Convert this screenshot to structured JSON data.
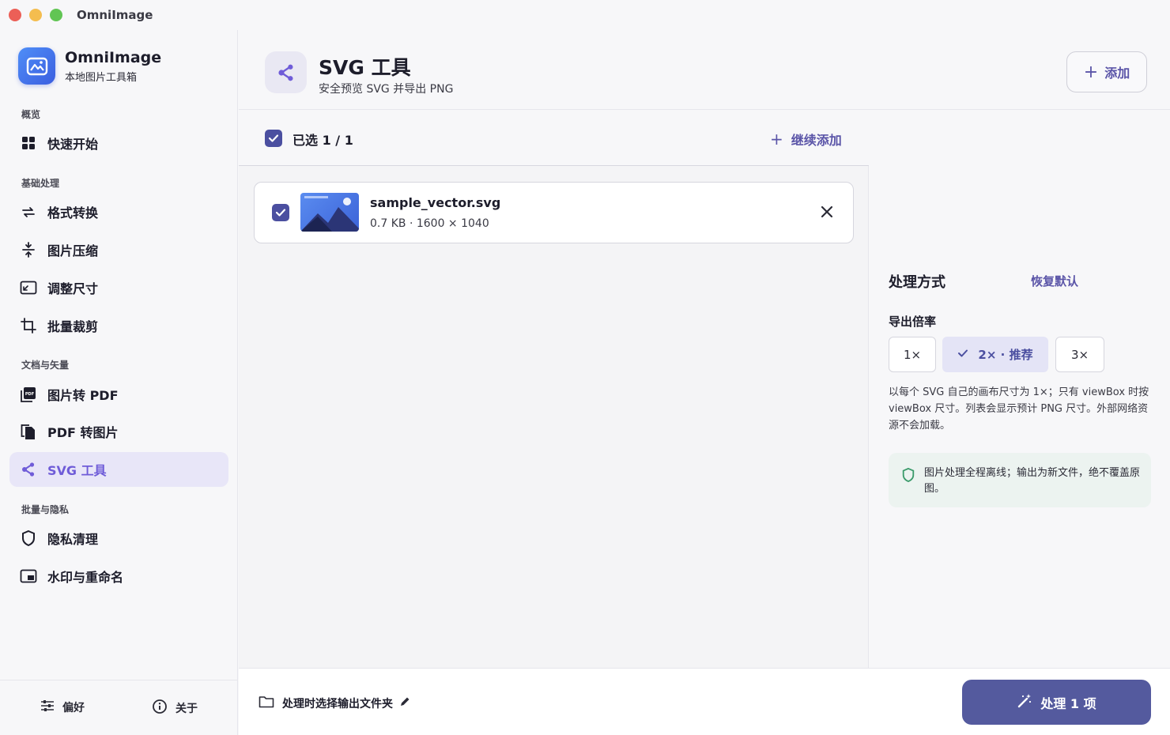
{
  "window": {
    "title": "OmniImage"
  },
  "brand": {
    "name": "OmniImage",
    "subtitle": "本地图片工具箱"
  },
  "sidebar": {
    "sections": [
      {
        "label": "概览"
      },
      {
        "label": "基础处理"
      },
      {
        "label": "文档与矢量"
      },
      {
        "label": "批量与隐私"
      }
    ],
    "items": [
      {
        "label": "快速开始",
        "icon": "grid-icon"
      },
      {
        "label": "格式转换",
        "icon": "swap-arrows-icon"
      },
      {
        "label": "图片压缩",
        "icon": "compress-icon"
      },
      {
        "label": "调整尺寸",
        "icon": "resize-icon"
      },
      {
        "label": "批量裁剪",
        "icon": "crop-icon"
      },
      {
        "label": "图片转 PDF",
        "icon": "pdf-icon"
      },
      {
        "label": "PDF 转图片",
        "icon": "pages-icon"
      },
      {
        "label": "SVG 工具",
        "icon": "share-nodes-icon",
        "active": true
      },
      {
        "label": "隐私清理",
        "icon": "shield-icon"
      },
      {
        "label": "水印与重命名",
        "icon": "watermark-icon"
      }
    ],
    "footer": {
      "preferences": "偏好",
      "about": "关于"
    }
  },
  "header": {
    "title": "SVG 工具",
    "subtitle": "安全预览 SVG 并导出 PNG",
    "add_label": "添加"
  },
  "list": {
    "selected_label": "已选 1 / 1",
    "continue_add": "继续添加",
    "files": [
      {
        "name": "sample_vector.svg",
        "meta": "0.7 KB · 1600 × 1040",
        "checked": true
      }
    ]
  },
  "settings": {
    "title": "处理方式",
    "reset": "恢复默认",
    "scale_label": "导出倍率",
    "scales": [
      {
        "label": "1×",
        "selected": false
      },
      {
        "label": "2× · 推荐",
        "selected": true
      },
      {
        "label": "3×",
        "selected": false
      }
    ],
    "description": "以每个 SVG 自己的画布尺寸为 1×；只有 viewBox 时按 viewBox 尺寸。列表会显示预计 PNG 尺寸。外部网络资源不会加载。",
    "notice": "图片处理全程离线；输出为新文件，绝不覆盖原图。"
  },
  "bottom": {
    "output_folder": "处理时选择输出文件夹",
    "process_label": "处理 1 项"
  },
  "colors": {
    "accent": "#5b55a8",
    "active_nav_bg": "#e8e6f8",
    "active_nav_text": "#6f5cd8",
    "process_button": "#545a9e",
    "notice_bg": "#ecf3f0"
  }
}
